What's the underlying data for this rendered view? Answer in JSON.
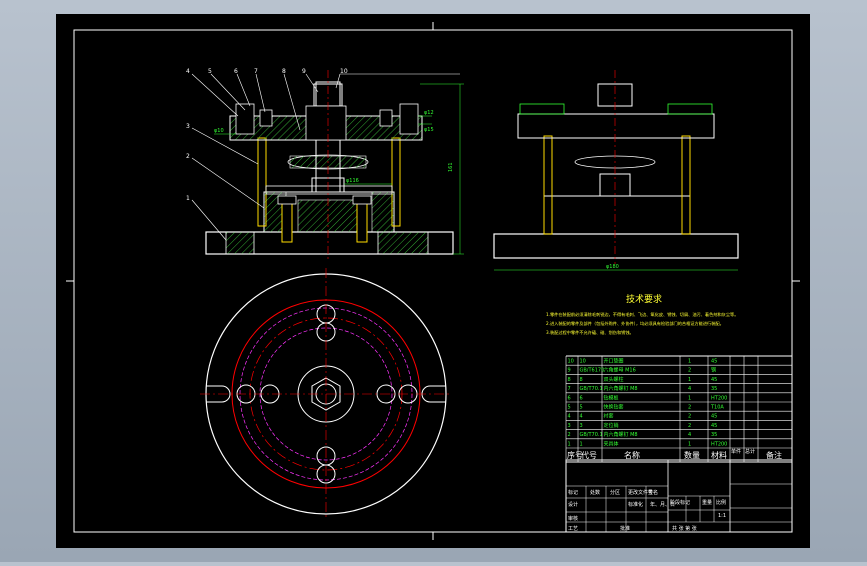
{
  "drawing": {
    "background": "#000000",
    "line_color": "#ffffff",
    "dimension_color": "#33ff33",
    "section_color": "#33aa33",
    "center_line_color": "#ff0000",
    "hidden_line_color": "#ff33ff",
    "table_color": "#ffffff"
  },
  "front_view": {
    "balloons": [
      "4",
      "5",
      "6",
      "7",
      "8",
      "9",
      "10",
      "3",
      "2",
      "1"
    ],
    "dimensions": {
      "height": "161",
      "bore": "φ116",
      "left_small": "φ10",
      "right_small_1": "φ12",
      "right_small_2": "φ15"
    }
  },
  "side_view": {
    "width_dim": "φ180"
  },
  "technical_requirements": {
    "title": "技术要求",
    "lines": [
      "1.零件在装配前必须清除毛刺锐边，不得有毛刺、飞边、氧化皮、锈蚀、切屑、油污、着色剂和灰尘等。",
      "2.进入装配的零件及部件（包括外购件、外协件），均必须具有检验部门的合格证方能进行装配。",
      "3.装配过程中零件不允许磕、碰、划伤和锈蚀。"
    ]
  },
  "parts_list": {
    "rows": [
      {
        "no": "10",
        "code": "10",
        "name": "开口垫圈",
        "qty": "1",
        "material": "45"
      },
      {
        "no": "9",
        "code": "GB/T6170",
        "name": "六角螺母 M16",
        "qty": "2",
        "material": "钢"
      },
      {
        "no": "8",
        "code": "8",
        "name": "双头螺柱",
        "qty": "1",
        "material": "45"
      },
      {
        "no": "7",
        "code": "GB/T70.1",
        "name": "内六角螺钉 M8",
        "qty": "4",
        "material": "35"
      },
      {
        "no": "6",
        "code": "6",
        "name": "钻模板",
        "qty": "1",
        "material": "HT200"
      },
      {
        "no": "5",
        "code": "5",
        "name": "快换钻套",
        "qty": "2",
        "material": "T10A"
      },
      {
        "no": "4",
        "code": "4",
        "name": "衬套",
        "qty": "2",
        "material": "45"
      },
      {
        "no": "3",
        "code": "3",
        "name": "定位销",
        "qty": "2",
        "material": "45"
      },
      {
        "no": "2",
        "code": "GB/T70.1",
        "name": "内六角螺钉 M8",
        "qty": "4",
        "material": "35"
      },
      {
        "no": "1",
        "code": "1",
        "name": "夹具体",
        "qty": "1",
        "material": "HT200"
      }
    ],
    "header": {
      "no": "序号",
      "code": "代号",
      "name": "名称",
      "qty": "数量",
      "material": "材料",
      "unit_weight": "单件",
      "total_weight": "总计",
      "remarks": "备注"
    }
  },
  "title_block": {
    "labels": [
      "标记",
      "处数",
      "分区",
      "更改文件号",
      "签名",
      "年、月、日"
    ],
    "designer": "设计",
    "review": "审核",
    "process": "工艺",
    "approve": "批准",
    "standard": "标准化",
    "stage_label": "阶段标记",
    "weight_label": "重量",
    "scale_label": "比例",
    "scale_value": "1:1",
    "sheet_label": "共 张 第 张"
  }
}
